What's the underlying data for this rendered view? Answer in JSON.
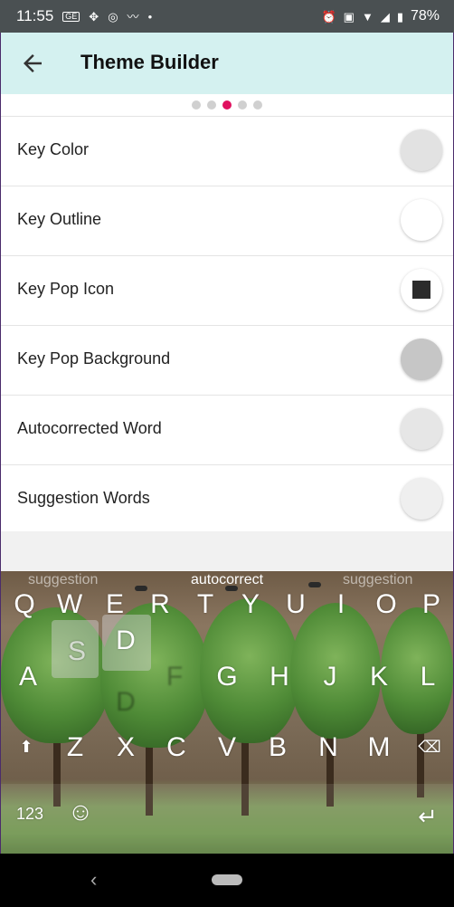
{
  "status_bar": {
    "time": "11:55",
    "left_icons": [
      "ge-icon",
      "game-icon",
      "instagram-icon",
      "mustache-icon",
      "dot-icon"
    ],
    "right_icons": [
      "alarm-icon",
      "cast-icon",
      "wifi-icon",
      "signal-icon",
      "battery-icon"
    ],
    "battery_percent": "78%"
  },
  "app_bar": {
    "title": "Theme Builder",
    "back_icon": "arrow-left-icon"
  },
  "pager": {
    "count": 5,
    "active_index": 2,
    "active_color": "#e0115f"
  },
  "settings": [
    {
      "label": "Key Color",
      "swatch_color": "#e2e2e2",
      "inner": ""
    },
    {
      "label": "Key Outline",
      "swatch_color": "#ffffff",
      "inner": ""
    },
    {
      "label": "Key Pop Icon",
      "swatch_color": "#ffffff",
      "inner": "#2b2b2b"
    },
    {
      "label": "Key Pop Background",
      "swatch_color": "#c6c6c6",
      "inner": ""
    },
    {
      "label": "Autocorrected Word",
      "swatch_color": "#e6e6e6",
      "inner": ""
    },
    {
      "label": "Suggestion Words",
      "swatch_color": "#efefef",
      "inner": ""
    }
  ],
  "keyboard": {
    "suggestions": {
      "left": "suggestion",
      "center": "autocorrect",
      "right": "suggestion"
    },
    "row1": [
      "Q",
      "W",
      "E",
      "R",
      "T",
      "Y",
      "U",
      "I",
      "O",
      "P"
    ],
    "row2": [
      "A",
      "S",
      "D",
      "F",
      "G",
      "H",
      "J",
      "K",
      "L"
    ],
    "row3": [
      "Z",
      "X",
      "C",
      "V",
      "B",
      "N",
      "M"
    ],
    "pop_key": "D",
    "shift_icon": "shift-arrow-icon",
    "backspace_icon": "backspace-icon",
    "numbers_label": "123",
    "emoji_icon": "smiley-icon",
    "enter_icon": "enter-icon"
  },
  "nav_bar": {
    "back_icon": "chevron-left-icon",
    "home_icon": "home-pill-icon"
  }
}
